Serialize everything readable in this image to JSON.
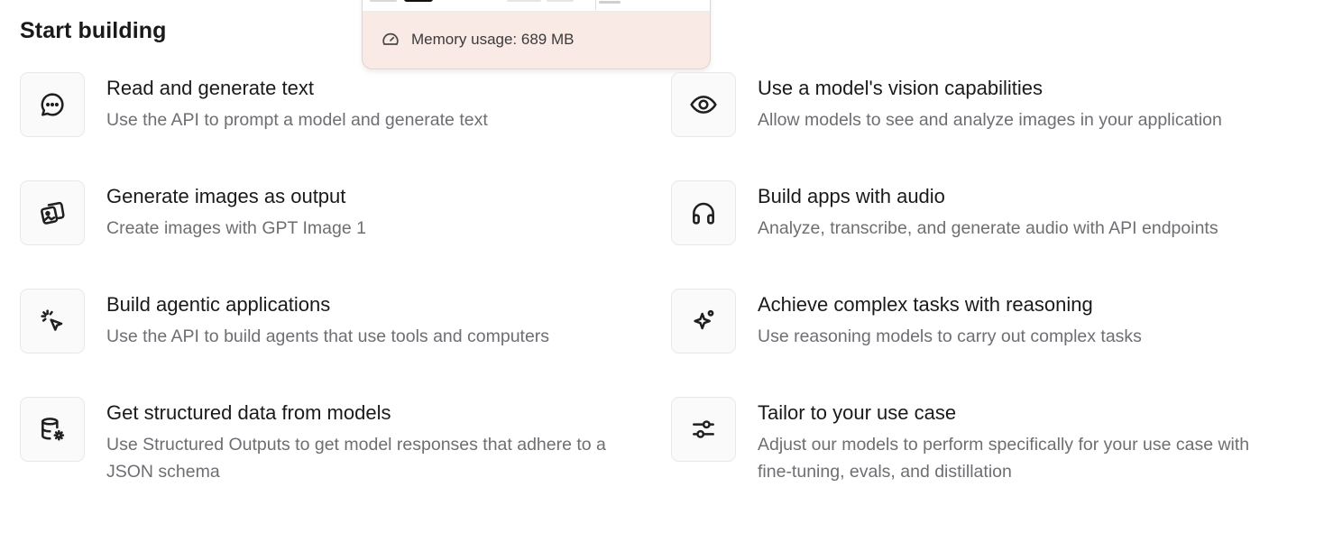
{
  "section": {
    "title": "Start building"
  },
  "memory_popup": {
    "label": "Memory usage: 689 MB",
    "icon": "gauge-icon",
    "background": "#faeae6"
  },
  "cards": [
    {
      "title": "Read and generate text",
      "desc": "Use the API to prompt a model and generate text",
      "icon": "chat-bubble-icon"
    },
    {
      "title": "Use a model's vision capabilities",
      "desc": "Allow models to see and analyze images in your application",
      "icon": "eye-icon"
    },
    {
      "title": "Generate images as output",
      "desc": "Create images with GPT Image 1",
      "icon": "images-icon"
    },
    {
      "title": "Build apps with audio",
      "desc": "Analyze, transcribe, and generate audio with API endpoints",
      "icon": "headphones-icon"
    },
    {
      "title": "Build agentic applications",
      "desc": "Use the API to build agents that use tools and computers",
      "icon": "cursor-click-icon"
    },
    {
      "title": "Achieve complex tasks with reasoning",
      "desc": "Use reasoning models to carry out complex tasks",
      "icon": "sparkle-icon"
    },
    {
      "title": "Get structured data from models",
      "desc": "Use Structured Outputs to get model responses that adhere to a JSON schema",
      "icon": "database-gear-icon"
    },
    {
      "title": "Tailor to your use case",
      "desc": "Adjust our models to perform specifically for your use case with fine-tuning, evals, and distillation",
      "icon": "sliders-icon"
    }
  ]
}
